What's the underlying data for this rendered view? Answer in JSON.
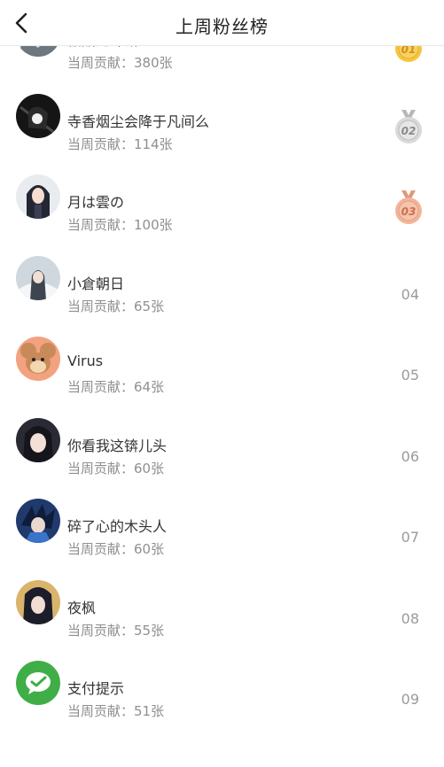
{
  "header": {
    "title": "上周粉丝榜",
    "back_icon": "chevron-left-icon"
  },
  "fans": [
    {
      "name": "糖醋龙虾钳",
      "contribution": "当周贡献：380张",
      "rank": "01",
      "medal": "gold",
      "avatar": "anime-avatar-gray"
    },
    {
      "name": "寺香烟尘会降于凡间么",
      "contribution": "当周贡献：114张",
      "rank": "02",
      "medal": "silver",
      "avatar": "anime-avatar-dark"
    },
    {
      "name": "月は雲の",
      "contribution": "当周贡献：100张",
      "rank": "03",
      "medal": "bronze",
      "avatar": "anime-girl-avatar"
    },
    {
      "name": "小倉朝日",
      "contribution": "当周贡献：65张",
      "rank": "04",
      "medal": "",
      "avatar": "anime-avatar-light"
    },
    {
      "name": "Virus",
      "contribution": "当周贡献：64张",
      "rank": "05",
      "medal": "",
      "avatar": "cartoon-mouse-avatar"
    },
    {
      "name": "你看我这锛儿头",
      "contribution": "当周贡献：60张",
      "rank": "06",
      "medal": "",
      "avatar": "anime-girl-avatar"
    },
    {
      "name": "碎了心的木头人",
      "contribution": "当周贡献：60张",
      "rank": "07",
      "medal": "",
      "avatar": "anime-boy-blue-avatar"
    },
    {
      "name": "夜枫",
      "contribution": "当周贡献：55张",
      "rank": "08",
      "medal": "",
      "avatar": "anime-girl-dark-avatar"
    },
    {
      "name": "支付提示",
      "contribution": "当周贡献：51张",
      "rank": "09",
      "medal": "",
      "avatar": "wechat-pay-avatar"
    }
  ],
  "colors": {
    "gold": "#f5c542",
    "gold_ribbon": "#e8a13a",
    "silver": "#d9d9d9",
    "silver_ribbon": "#b7b7b7",
    "bronze": "#f2b59a",
    "bronze_ribbon": "#e0987a",
    "wechat_green": "#3fae47",
    "mouse_bg": "#f2a27f"
  }
}
